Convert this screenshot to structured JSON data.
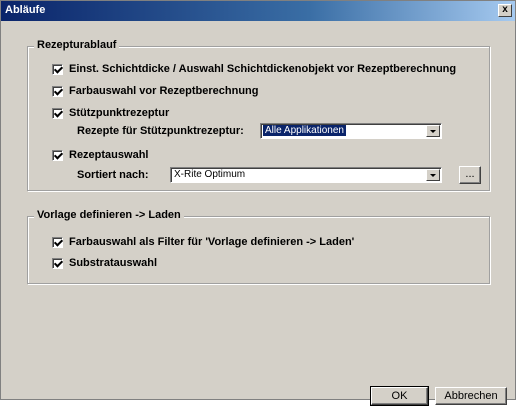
{
  "window": {
    "title": "Abläufe",
    "close_label": "x"
  },
  "rezepturablauf": {
    "title": "Rezepturablauf",
    "items": [
      {
        "label": "Einst. Schichtdicke / Auswahl Schichtdickenobjekt vor Rezeptberechnung",
        "checked": true
      },
      {
        "label": "Farbauswahl vor Rezeptberechnung",
        "checked": true
      },
      {
        "label": "Stützpunktrezeptur",
        "checked": true
      },
      {
        "label": "Rezeptauswahl",
        "checked": true
      }
    ],
    "stuetz_label": "Rezepte für Stützpunktrezeptur:",
    "stuetz_value": "Alle Applikationen",
    "sort_label": "Sortiert nach:",
    "sort_value": "X-Rite Optimum",
    "browse_label": "..."
  },
  "vorlage": {
    "title": "Vorlage definieren -> Laden",
    "items": [
      {
        "label": "Farbauswahl als Filter für 'Vorlage definieren -> Laden'",
        "checked": true
      },
      {
        "label": "Substratauswahl",
        "checked": true
      }
    ]
  },
  "buttons": {
    "ok": "OK",
    "cancel": "Abbrechen"
  }
}
